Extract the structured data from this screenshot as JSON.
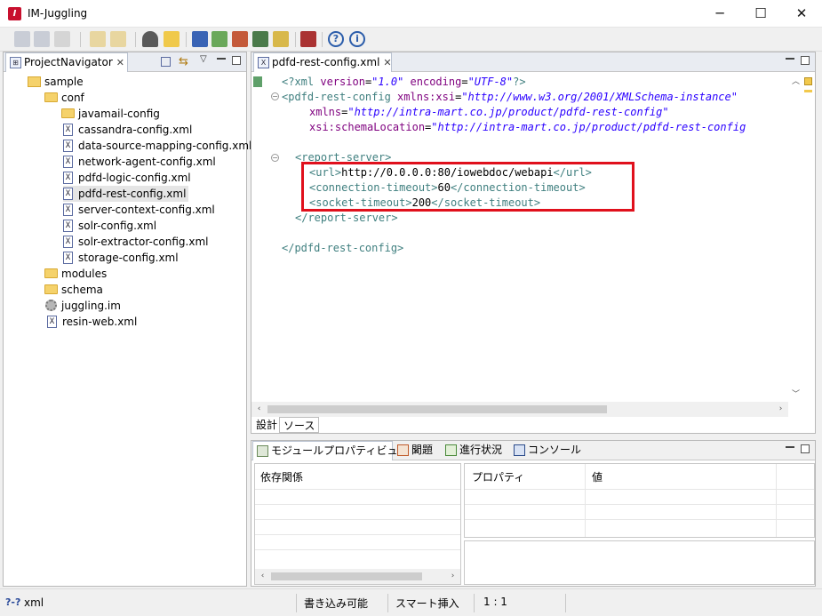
{
  "window": {
    "title": "IM-Juggling",
    "minimize": "─",
    "maximize": "☐",
    "close": "✕"
  },
  "navigator": {
    "tab_label": "ProjectNavigator",
    "tree": [
      {
        "label": "sample",
        "type": "project"
      },
      {
        "label": "conf",
        "type": "folder"
      },
      {
        "label": "javamail-config",
        "type": "folder"
      },
      {
        "label": "cassandra-config.xml",
        "type": "xml"
      },
      {
        "label": "data-source-mapping-config.xml",
        "type": "xml"
      },
      {
        "label": "network-agent-config.xml",
        "type": "xml"
      },
      {
        "label": "pdfd-logic-config.xml",
        "type": "xml"
      },
      {
        "label": "pdfd-rest-config.xml",
        "type": "xml",
        "selected": true
      },
      {
        "label": "server-context-config.xml",
        "type": "xml"
      },
      {
        "label": "solr-config.xml",
        "type": "xml"
      },
      {
        "label": "solr-extractor-config.xml",
        "type": "xml"
      },
      {
        "label": "storage-config.xml",
        "type": "xml"
      },
      {
        "label": "modules",
        "type": "folder"
      },
      {
        "label": "schema",
        "type": "folder"
      },
      {
        "label": "juggling.im",
        "type": "gear"
      },
      {
        "label": "resin-web.xml",
        "type": "xml"
      }
    ]
  },
  "editor": {
    "tab_label": "pdfd-rest-config.xml",
    "lines": {
      "l1_open": "<?xml ",
      "l1_a1": "version",
      "l1_eq1": "=",
      "l1_v1": "\"1.0\"",
      "l1_a2": " encoding",
      "l1_eq2": "=",
      "l1_v2": "\"UTF-8\"",
      "l1_close": "?>",
      "l2_tag": "<pdfd-rest-config ",
      "l2_attr": "xmlns:xsi",
      "l2_eq": "=",
      "l2_val": "\"http://www.w3.org/2001/XMLSchema-instance\"",
      "l3_attr": "xmlns",
      "l3_eq": "=",
      "l3_val": "\"http://intra-mart.co.jp/product/pdfd-rest-config\"",
      "l4_attr": "xsi:schemaLocation",
      "l4_eq": "=",
      "l4_val": "\"http://intra-mart.co.jp/product/pdfd-rest-config",
      "l6_tag": "<report-server>",
      "l7_open": "<url>",
      "l7_text": "http://0.0.0.0:80/iowebdoc/webapi",
      "l7_close": "</url>",
      "l8_open": "<connection-timeout>",
      "l8_text": "60",
      "l8_close": "</connection-timeout>",
      "l9_open": "<socket-timeout>",
      "l9_text": "200",
      "l9_close": "</socket-timeout>",
      "l10_tag": "</report-server>",
      "l12_tag": "</pdfd-rest-config>"
    },
    "bottom_tabs": {
      "design": "設計",
      "source": "ソース"
    },
    "highlight_color": "#e0101c"
  },
  "bottom_panel": {
    "tabs": [
      {
        "label": "モジュールプロパティビュー"
      },
      {
        "label": "問題"
      },
      {
        "label": "進行状況"
      },
      {
        "label": "コンソール"
      }
    ],
    "left_header": "依存関係",
    "col_property": "プロパティ",
    "col_value": "値"
  },
  "statusbar": {
    "type": "xml",
    "type_icon": "?-?",
    "writable": "書き込み可能",
    "insert_mode": "スマート挿入",
    "position": "1 : 1"
  }
}
